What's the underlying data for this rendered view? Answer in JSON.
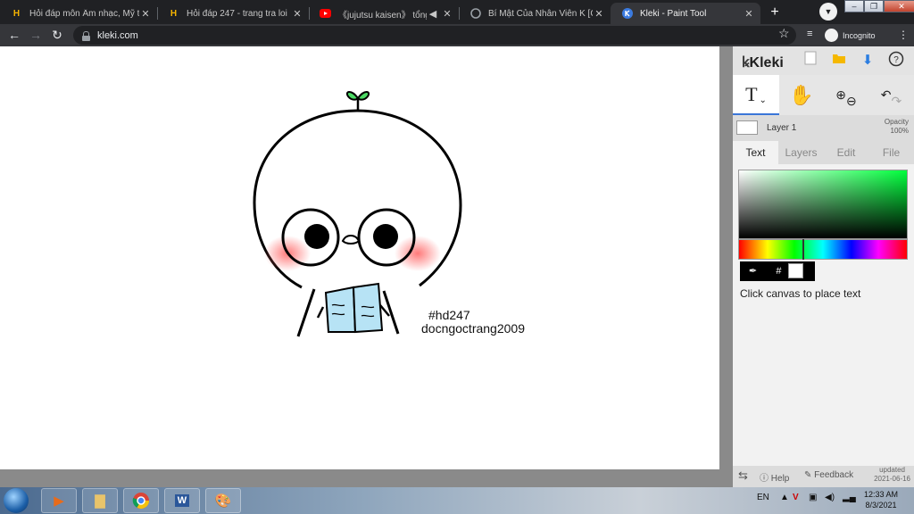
{
  "tabs": [
    {
      "title": "Hỏi đáp môn Âm nhạc, Mỹ thuật",
      "icon": "hoidap247-icon"
    },
    {
      "title": "Hỏi đáp 247 - trang tra loi",
      "icon": "hoidap247-icon"
    },
    {
      "title": "《jujutsu kaisen》 tổng hợp",
      "icon": "youtube-icon"
    },
    {
      "title": "Bí Mật Của Nhân Viên K [Chap",
      "icon": "comic-site-icon"
    },
    {
      "title": "Kleki - Paint Tool",
      "icon": "kleki-icon"
    }
  ],
  "active_tab_index": 4,
  "address": {
    "url": "kleki.com"
  },
  "profile": {
    "label": "Incognito"
  },
  "kleki": {
    "logo": "Kleki",
    "layer": {
      "name": "Layer 1",
      "opacity_label": "Opacity",
      "opacity_value": "100%"
    },
    "panel_tabs": [
      "Text",
      "Layers",
      "Edit",
      "File"
    ],
    "active_panel_tab": "Text",
    "picker_icons": [
      "eyedropper-icon",
      "hash"
    ],
    "picker_hash": "#",
    "hint": "Click canvas to place text",
    "footer": {
      "help": "Help",
      "feedback": "Feedback",
      "updated_label": "updated",
      "updated_date": "2021-06-16"
    },
    "text_tool_label": "T",
    "colors": {
      "primary": "#ffffff",
      "hue_accent": "#00ff3c"
    }
  },
  "canvas": {
    "text_line1": "#hd247",
    "text_line2": "docngoctrang2009"
  },
  "taskbar": {
    "tray_lang": "EN",
    "clock_time": "12:33 AM",
    "clock_date": "8/3/2021"
  }
}
